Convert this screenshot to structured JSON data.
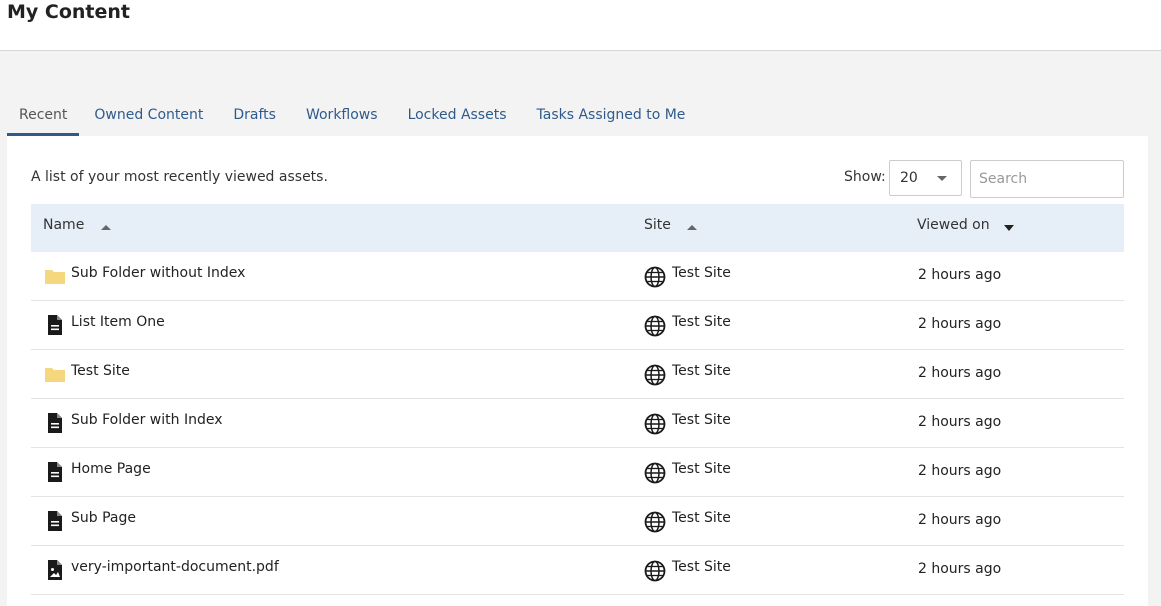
{
  "page": {
    "title": "My Content"
  },
  "tabs": [
    {
      "label": "Recent",
      "active": true
    },
    {
      "label": "Owned Content",
      "active": false
    },
    {
      "label": "Drafts",
      "active": false
    },
    {
      "label": "Workflows",
      "active": false
    },
    {
      "label": "Locked Assets",
      "active": false
    },
    {
      "label": "Tasks Assigned to Me",
      "active": false
    }
  ],
  "panel": {
    "description": "A list of your most recently viewed assets.",
    "show_label": "Show:",
    "show_value": "20",
    "search_placeholder": "Search"
  },
  "table": {
    "columns": [
      {
        "label": "Name",
        "sort": "asc"
      },
      {
        "label": "Site",
        "sort": "asc"
      },
      {
        "label": "Viewed on",
        "sort": "desc"
      }
    ],
    "rows": [
      {
        "icon": "folder-icon",
        "name": "Sub Folder without Index",
        "site": "Test Site",
        "viewed": "2 hours ago"
      },
      {
        "icon": "document-icon",
        "name": "List Item One",
        "site": "Test Site",
        "viewed": "2 hours ago"
      },
      {
        "icon": "folder-icon",
        "name": "Test Site",
        "site": "Test Site",
        "viewed": "2 hours ago"
      },
      {
        "icon": "document-icon",
        "name": "Sub Folder with Index",
        "site": "Test Site",
        "viewed": "2 hours ago"
      },
      {
        "icon": "document-icon",
        "name": "Home Page",
        "site": "Test Site",
        "viewed": "2 hours ago"
      },
      {
        "icon": "document-icon",
        "name": "Sub Page",
        "site": "Test Site",
        "viewed": "2 hours ago"
      },
      {
        "icon": "image-file-icon",
        "name": "very-important-document.pdf",
        "site": "Test Site",
        "viewed": "2 hours ago"
      }
    ]
  },
  "colors": {
    "accent": "#2f5b8c",
    "header_row_bg": "#e6eff8",
    "folder": "#f5d77d"
  }
}
